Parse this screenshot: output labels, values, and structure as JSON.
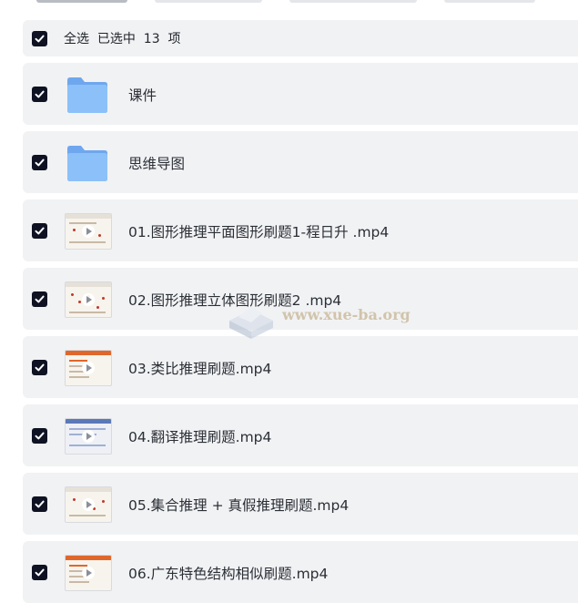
{
  "select_all": {
    "checked": true,
    "label": "全选  已选中  13  项"
  },
  "files": [
    {
      "name": "课件",
      "kind": "folder",
      "checked": true
    },
    {
      "name": "思维导图",
      "kind": "folder",
      "checked": true
    },
    {
      "name": "01.图形推理平面图形刷题1-程日升 .mp4",
      "kind": "video",
      "checked": true
    },
    {
      "name": "02.图形推理立体图形刷题2 .mp4",
      "kind": "video",
      "checked": true
    },
    {
      "name": "03.类比推理刷题.mp4",
      "kind": "video",
      "checked": true
    },
    {
      "name": "04.翻译推理刷题.mp4",
      "kind": "video",
      "checked": true
    },
    {
      "name": "05.集合推理 + 真假推理刷题.mp4",
      "kind": "video",
      "checked": true
    },
    {
      "name": "06.广东特色结构相似刷题.mp4",
      "kind": "video",
      "checked": true
    }
  ],
  "watermark": {
    "text": "www.xue-ba.org"
  },
  "colors": {
    "row_bg": "#f1f2f4",
    "checkbox": "#0f1222",
    "folder": "#7fb6f5",
    "thumb_accent": "#e0672b"
  },
  "icons": {
    "check": "check-icon",
    "folder": "folder-icon",
    "video": "video-thumbnail-icon"
  }
}
